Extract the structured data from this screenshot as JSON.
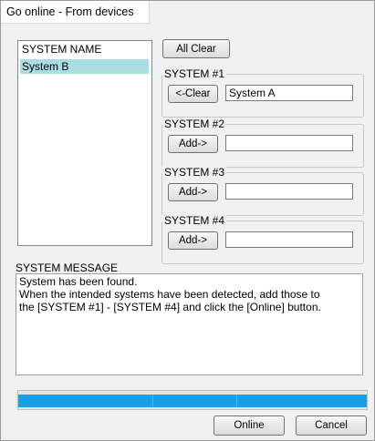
{
  "window": {
    "title": "Go online - From devices"
  },
  "system_list": {
    "header": "SYSTEM NAME",
    "items": [
      "System B"
    ]
  },
  "toolbar": {
    "all_clear_label": "All Clear"
  },
  "systems": [
    {
      "label": "SYSTEM #1",
      "button_label": "<-Clear",
      "value": "System A"
    },
    {
      "label": "SYSTEM #2",
      "button_label": "Add->",
      "value": ""
    },
    {
      "label": "SYSTEM #3",
      "button_label": "Add->",
      "value": ""
    },
    {
      "label": "SYSTEM #4",
      "button_label": "Add->",
      "value": ""
    }
  ],
  "message": {
    "label": "SYSTEM MESSAGE",
    "lines": [
      "System has been found.",
      "When the intended systems have been detected, add those to",
      "the [SYSTEM #1] - [SYSTEM #4] and click the [Online] button."
    ]
  },
  "progress": {
    "fraction": 1.0
  },
  "footer": {
    "online_label": "Online",
    "cancel_label": "Cancel"
  },
  "colors": {
    "selection": "#a8dde3",
    "progress": "#1aa0e6"
  }
}
